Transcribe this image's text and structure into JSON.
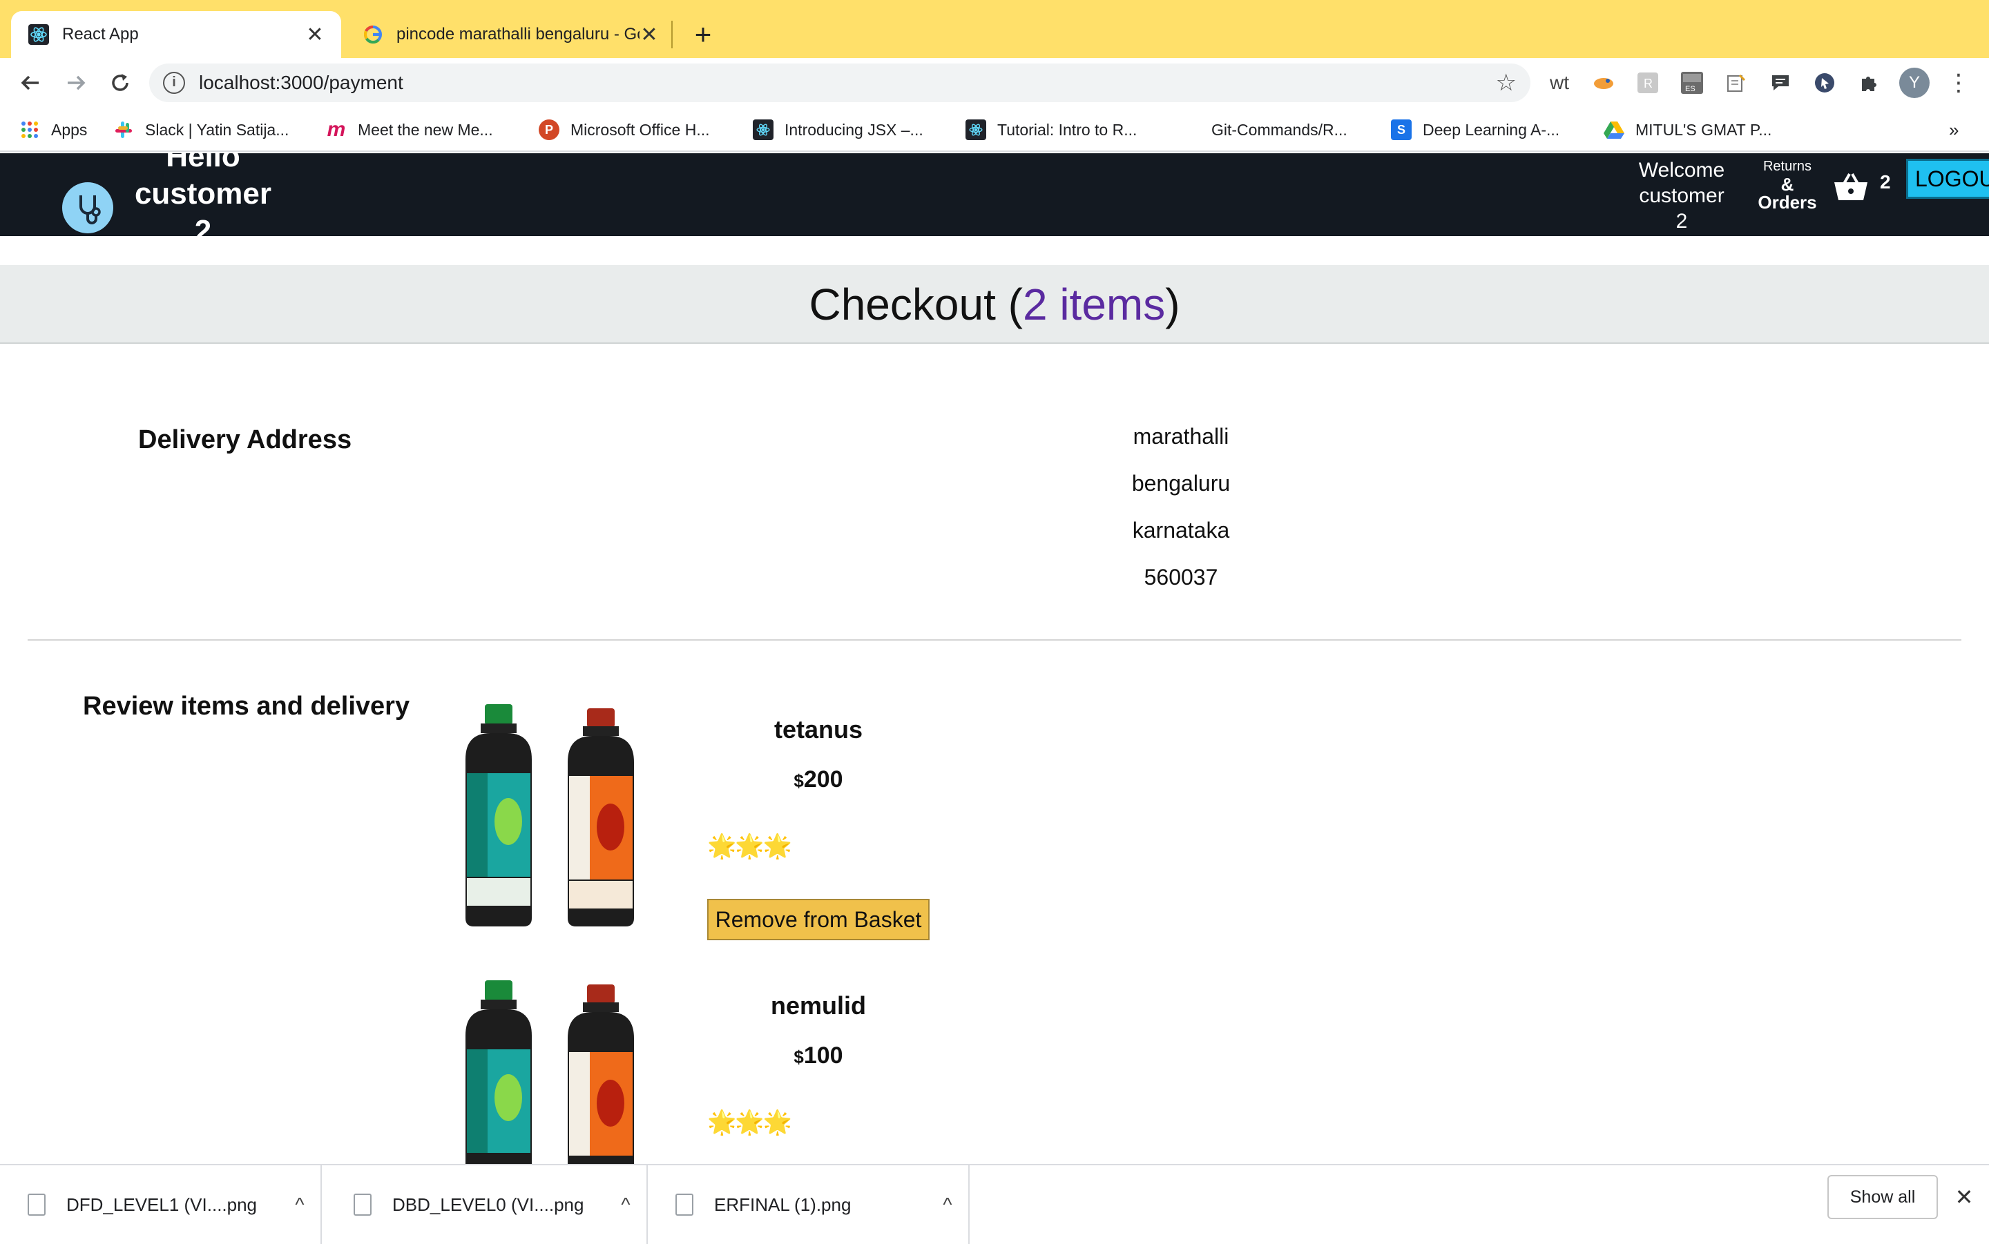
{
  "browser": {
    "tabs": [
      {
        "title": "React App",
        "favicon": "react-icon",
        "active": true
      },
      {
        "title": "pincode marathalli bengaluru - Google Search",
        "favicon": "google-icon",
        "active": false
      }
    ],
    "new_tab": "+",
    "close_glyph": "✕",
    "url": "localhost:3000/payment",
    "extensions": [
      "wt",
      "ES"
    ],
    "profile_initial": "Y",
    "bookmarks": [
      {
        "label": "Apps",
        "icon": "apps-grid-icon"
      },
      {
        "label": "Slack | Yatin Satija...",
        "icon": "slack-icon"
      },
      {
        "label": "Meet the new Me...",
        "icon": "m-logo-icon"
      },
      {
        "label": "Microsoft Office H...",
        "icon": "powerpoint-icon"
      },
      {
        "label": "Introducing JSX –...",
        "icon": "react-icon"
      },
      {
        "label": "Tutorial: Intro to R...",
        "icon": "react-icon"
      },
      {
        "label": "Git-Commands/R...",
        "icon": "none"
      },
      {
        "label": "Deep Learning A-...",
        "icon": "s-icon"
      },
      {
        "label": "MITUL'S GMAT P...",
        "icon": "google-drive-icon"
      }
    ],
    "bookmarks_overflow": "»"
  },
  "header": {
    "hello_lines": [
      "Hello",
      "customer",
      "2"
    ],
    "welcome_lines": [
      "Welcome",
      "customer",
      "2"
    ],
    "returns_line1": "Returns",
    "returns_line2": "&",
    "returns_line3": "Orders",
    "basket_count": "2",
    "logout_label": "LOGOUT"
  },
  "checkout": {
    "title_prefix": "Checkout (",
    "items_count": "2 items",
    "title_suffix": ")"
  },
  "delivery": {
    "label": "Delivery Address",
    "lines": [
      "marathalli",
      "bengaluru",
      "karnataka",
      "560037"
    ]
  },
  "review": {
    "label": "Review items and delivery",
    "items": [
      {
        "name": "tetanus",
        "currency": "$",
        "price": "200",
        "rating": 3,
        "rating_glyphs": "🌟🌟🌟",
        "remove_label": "Remove from Basket"
      },
      {
        "name": "nemulid",
        "currency": "$",
        "price": "100",
        "rating": 3,
        "rating_glyphs": "🌟🌟🌟"
      }
    ]
  },
  "downloads": {
    "files": [
      "DFD_LEVEL1 (VI....png",
      "DBD_LEVEL0 (VI....png",
      "ERFINAL (1).png"
    ],
    "show_all": "Show all",
    "expand_glyph": "^",
    "close_glyph": "✕"
  },
  "colors": {
    "tabstrip": "#ffe06a",
    "app_header": "#131921",
    "items_count": "#5a2aa0",
    "remove_button": "#f0c14b",
    "logout_button": "#1fc0f0"
  }
}
